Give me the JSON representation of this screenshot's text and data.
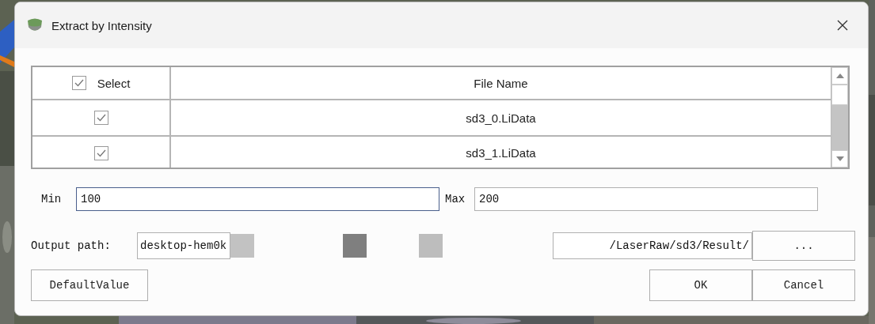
{
  "window": {
    "title": "Extract by Intensity"
  },
  "table": {
    "select_all_checked": true,
    "columns": [
      "Select",
      "File Name"
    ],
    "rows": [
      {
        "checked": true,
        "file_name": "sd3_0.LiData"
      },
      {
        "checked": true,
        "file_name": "sd3_1.LiData"
      }
    ]
  },
  "min": {
    "label": "Min",
    "value": "100",
    "focused": true
  },
  "max": {
    "label": "Max",
    "value": "200",
    "focused": false
  },
  "output_path": {
    "label": "Output path:",
    "value_start": "desktop-hem0k",
    "value_end": "/LaserRaw/sd3/Result/",
    "browse_button": "..."
  },
  "default_button": "DefaultValue",
  "buttons": [
    "OK",
    "Cancel"
  ]
}
